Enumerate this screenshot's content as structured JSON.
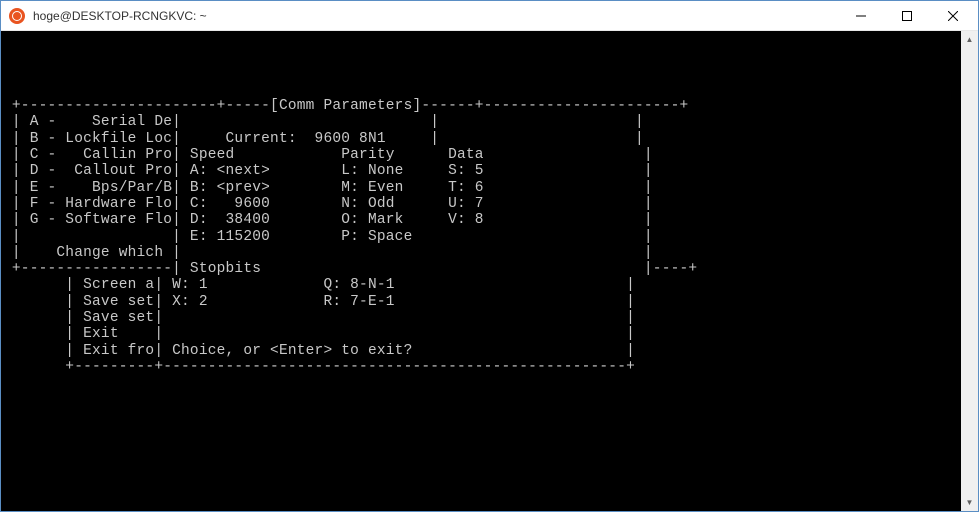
{
  "window": {
    "title": "hoge@DESKTOP-RCNGKVC: ~"
  },
  "terminal": {
    "lines": [
      "",
      "",
      "",
      "",
      " +----------------------+-----[Comm Parameters]------+----------------------+",
      " | A -    Serial De|                            |                      |",
      " | B - Lockfile Loc|     Current:  9600 8N1     |                      |",
      " | C -   Callin Pro| Speed            Parity      Data                  |",
      " | D -  Callout Pro| A: <next>        L: None     S: 5                  |",
      " | E -    Bps/Par/B| B: <prev>        M: Even     T: 6                  |",
      " | F - Hardware Flo| C:   9600        N: Odd      U: 7                  |",
      " | G - Software Flo| D:  38400        O: Mark     V: 8                  |",
      " |                 | E: 115200        P: Space                          |",
      " |    Change which |                                                    |",
      " +-----------------| Stopbits                                           |----+",
      "       | Screen a| W: 1             Q: 8-N-1                          |",
      "       | Save set| X: 2             R: 7-E-1                          |",
      "       | Save set|                                                    |",
      "       | Exit    |                                                    |",
      "       | Exit fro| Choice, or <Enter> to exit?                        |",
      "       +---------+----------------------------------------------------+"
    ]
  },
  "menu": {
    "back": {
      "items": [
        {
          "key": "A",
          "label": "Serial De"
        },
        {
          "key": "B",
          "label": "Lockfile Loc"
        },
        {
          "key": "C",
          "label": "Callin Pro"
        },
        {
          "key": "D",
          "label": "Callout Pro"
        },
        {
          "key": "E",
          "label": "Bps/Par/B"
        },
        {
          "key": "F",
          "label": "Hardware Flo"
        },
        {
          "key": "G",
          "label": "Software Flo"
        }
      ],
      "prompt": "Change which",
      "bottom_items": [
        "Screen a",
        "Save set",
        "Save set",
        "Exit",
        "Exit fro"
      ]
    },
    "dialog": {
      "title": "Comm Parameters",
      "current_label": "Current:",
      "current_value": "9600 8N1",
      "headers": {
        "speed": "Speed",
        "parity": "Parity",
        "data": "Data"
      },
      "speed": [
        {
          "key": "A",
          "val": "<next>"
        },
        {
          "key": "B",
          "val": "<prev>"
        },
        {
          "key": "C",
          "val": "9600"
        },
        {
          "key": "D",
          "val": "38400"
        },
        {
          "key": "E",
          "val": "115200"
        }
      ],
      "parity": [
        {
          "key": "L",
          "val": "None"
        },
        {
          "key": "M",
          "val": "Even"
        },
        {
          "key": "N",
          "val": "Odd"
        },
        {
          "key": "O",
          "val": "Mark"
        },
        {
          "key": "P",
          "val": "Space"
        }
      ],
      "data": [
        {
          "key": "S",
          "val": "5"
        },
        {
          "key": "T",
          "val": "6"
        },
        {
          "key": "U",
          "val": "7"
        },
        {
          "key": "V",
          "val": "8"
        }
      ],
      "stopbits_label": "Stopbits",
      "stopbits": [
        {
          "key": "W",
          "val": "1"
        },
        {
          "key": "X",
          "val": "2"
        }
      ],
      "presets": [
        {
          "key": "Q",
          "val": "8-N-1"
        },
        {
          "key": "R",
          "val": "7-E-1"
        }
      ],
      "prompt": "Choice, or <Enter> to exit?"
    }
  }
}
